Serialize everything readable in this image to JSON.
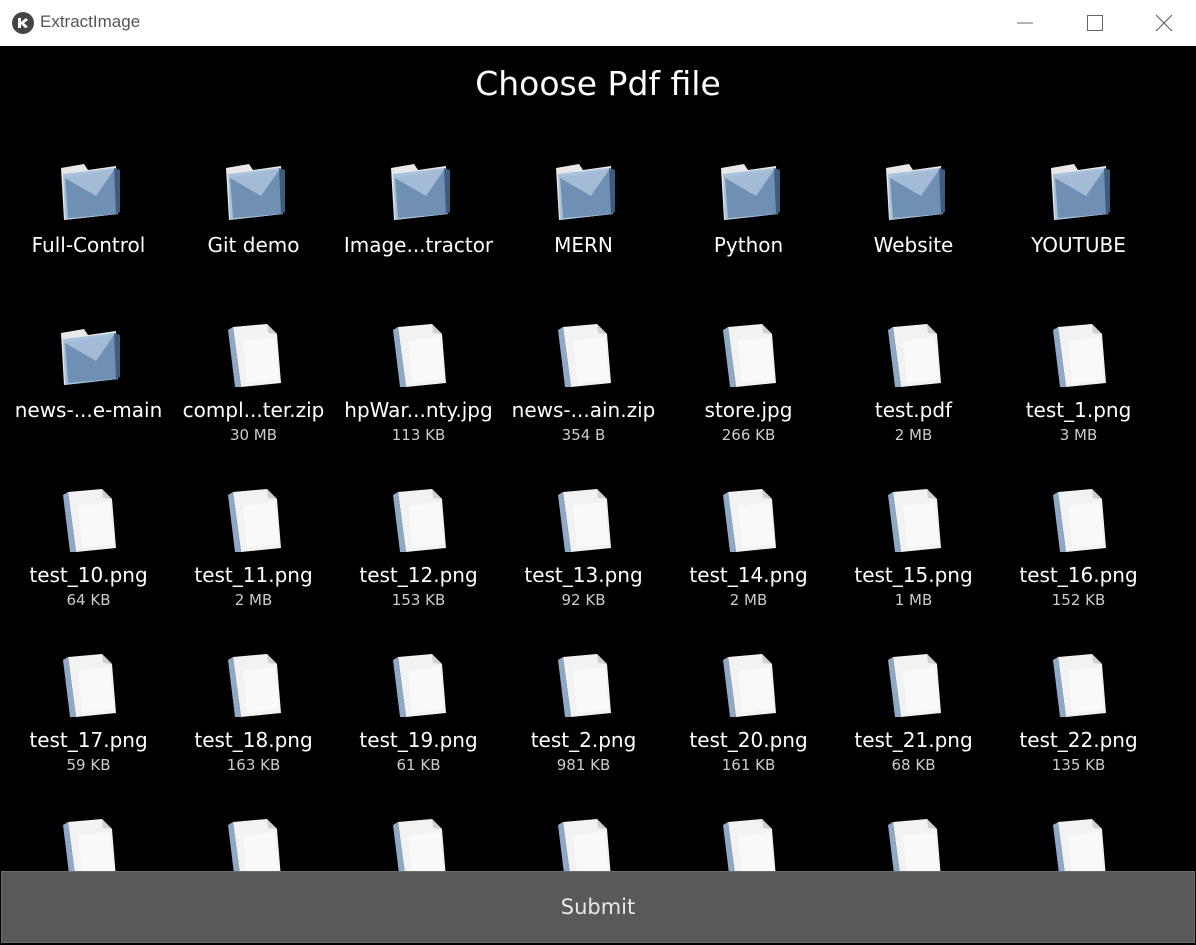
{
  "window": {
    "title": "ExtractImage"
  },
  "heading": "Choose Pdf file",
  "submit_label": "Submit",
  "colors": {
    "background": "#000000",
    "submit_bg": "#595959",
    "folder": "#6f8fb3"
  },
  "items": [
    {
      "type": "folder",
      "name": "Full-Control",
      "size": ""
    },
    {
      "type": "folder",
      "name": "Git demo",
      "size": ""
    },
    {
      "type": "folder",
      "name": "Image...tractor",
      "size": ""
    },
    {
      "type": "folder",
      "name": "MERN",
      "size": ""
    },
    {
      "type": "folder",
      "name": "Python",
      "size": ""
    },
    {
      "type": "folder",
      "name": "Website",
      "size": ""
    },
    {
      "type": "folder",
      "name": "YOUTUBE",
      "size": ""
    },
    {
      "type": "folder",
      "name": "news-...e-main",
      "size": ""
    },
    {
      "type": "file",
      "name": "compl...ter.zip",
      "size": "30 MB"
    },
    {
      "type": "file",
      "name": "hpWar...nty.jpg",
      "size": "113 KB"
    },
    {
      "type": "file",
      "name": "news-...ain.zip",
      "size": "354 B"
    },
    {
      "type": "file",
      "name": "store.jpg",
      "size": "266 KB"
    },
    {
      "type": "file",
      "name": "test.pdf",
      "size": "2 MB"
    },
    {
      "type": "file",
      "name": "test_1.png",
      "size": "3 MB"
    },
    {
      "type": "file",
      "name": "test_10.png",
      "size": "64 KB"
    },
    {
      "type": "file",
      "name": "test_11.png",
      "size": "2 MB"
    },
    {
      "type": "file",
      "name": "test_12.png",
      "size": "153 KB"
    },
    {
      "type": "file",
      "name": "test_13.png",
      "size": "92 KB"
    },
    {
      "type": "file",
      "name": "test_14.png",
      "size": "2 MB"
    },
    {
      "type": "file",
      "name": "test_15.png",
      "size": "1 MB"
    },
    {
      "type": "file",
      "name": "test_16.png",
      "size": "152 KB"
    },
    {
      "type": "file",
      "name": "test_17.png",
      "size": "59 KB"
    },
    {
      "type": "file",
      "name": "test_18.png",
      "size": "163 KB"
    },
    {
      "type": "file",
      "name": "test_19.png",
      "size": "61 KB"
    },
    {
      "type": "file",
      "name": "test_2.png",
      "size": "981 KB"
    },
    {
      "type": "file",
      "name": "test_20.png",
      "size": "161 KB"
    },
    {
      "type": "file",
      "name": "test_21.png",
      "size": "68 KB"
    },
    {
      "type": "file",
      "name": "test_22.png",
      "size": "135 KB"
    },
    {
      "type": "file",
      "name": "",
      "size": ""
    },
    {
      "type": "file",
      "name": "",
      "size": ""
    },
    {
      "type": "file",
      "name": "",
      "size": ""
    },
    {
      "type": "file",
      "name": "",
      "size": ""
    },
    {
      "type": "file",
      "name": "",
      "size": ""
    },
    {
      "type": "file",
      "name": "",
      "size": ""
    },
    {
      "type": "file",
      "name": "",
      "size": ""
    }
  ]
}
